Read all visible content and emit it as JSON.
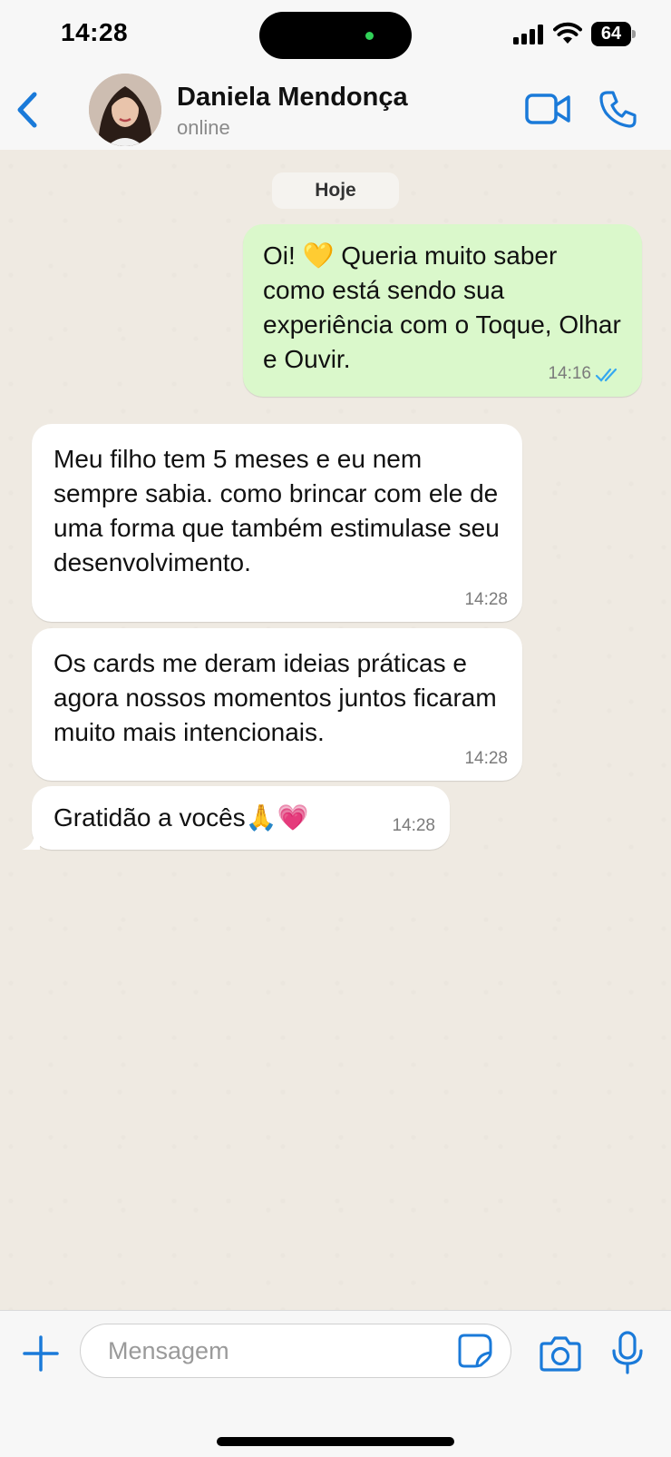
{
  "status_bar": {
    "time": "14:28",
    "battery": "64"
  },
  "header": {
    "contact_name": "Daniela Mendonça",
    "contact_status": "online"
  },
  "chat": {
    "date_label": "Hoje",
    "messages": [
      {
        "direction": "outgoing",
        "text_before_emoji": "Oi! ",
        "emoji": "💛",
        "text_after_emoji": " Queria muito saber como está sendo sua experiência com o Toque, Olhar e Ouvir.",
        "time": "14:16",
        "read": true
      },
      {
        "direction": "incoming",
        "text": "Meu filho tem 5 meses e eu nem sempre sabia. como brincar com ele de uma forma que também estimulase seu desenvolvimento.",
        "time": "14:28"
      },
      {
        "direction": "incoming",
        "text": "Os cards me deram ideias práticas e agora nossos momentos juntos ficaram muito mais intencionais.",
        "time": "14:28"
      },
      {
        "direction": "incoming",
        "text": "Gratidão a vocês",
        "emoji_1": "🙏",
        "emoji_2": "💗",
        "time": "14:28"
      }
    ]
  },
  "composer": {
    "placeholder": "Mensagem"
  },
  "colors": {
    "accent": "#1a7ad9",
    "outgoing_bubble": "#daf8cb",
    "incoming_bubble": "#ffffff",
    "chat_background": "#efeae2",
    "read_ticks": "#34a8f0"
  }
}
